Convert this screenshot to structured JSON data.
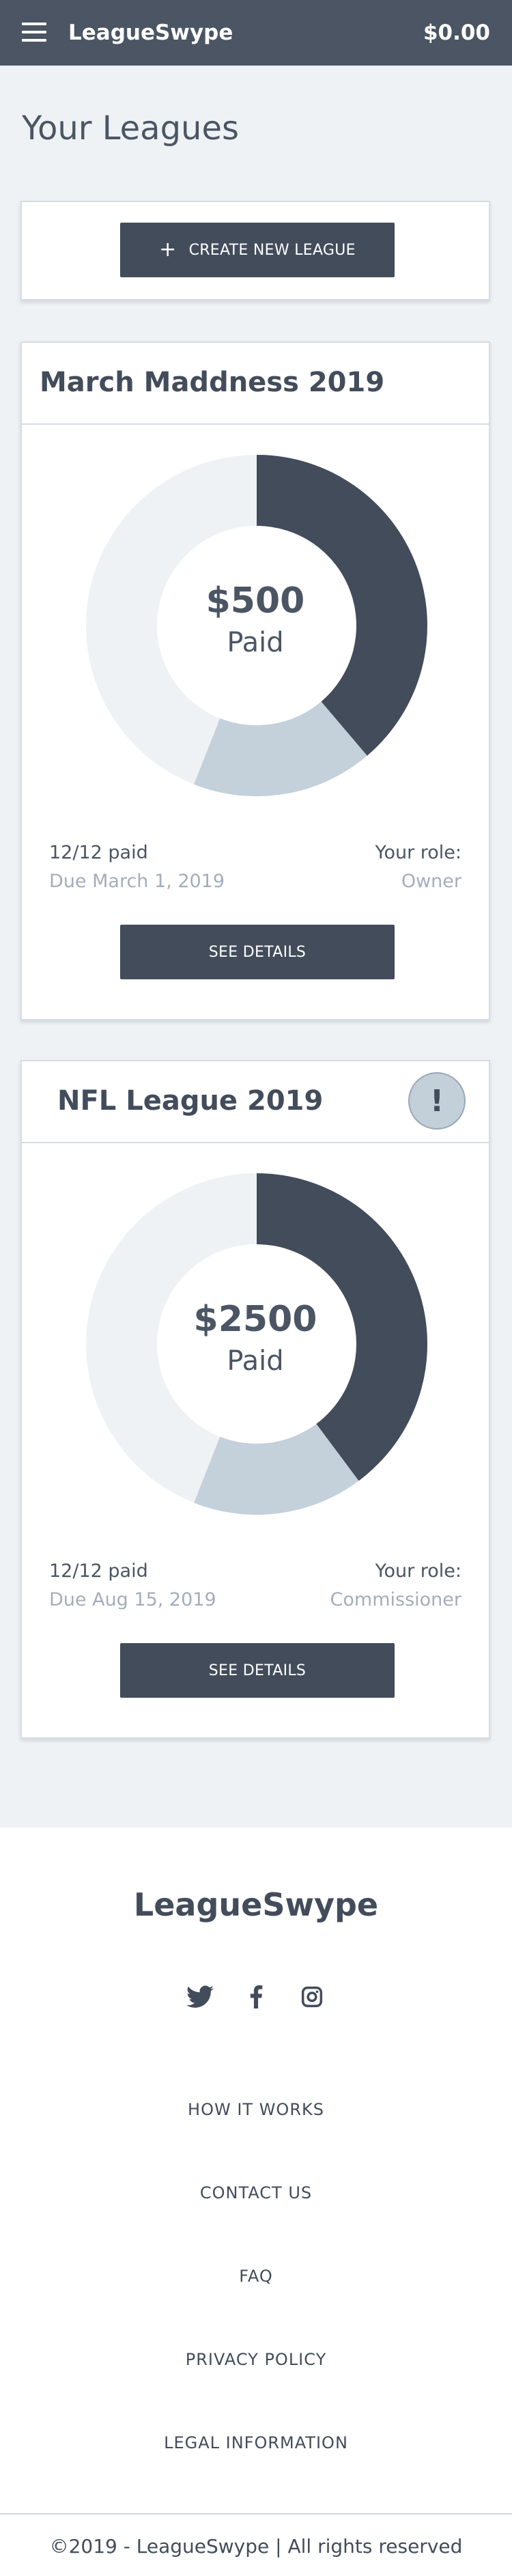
{
  "header": {
    "app_title": "LeagueSwype",
    "balance": "$0.00"
  },
  "page": {
    "title": "Your Leagues"
  },
  "create_button": {
    "label": "CREATE NEW LEAGUE"
  },
  "leagues": [
    {
      "name": "March Maddness 2019",
      "amount": "$500",
      "amount_label": "Paid",
      "paid_count": "12/12 paid",
      "due": "Due March 1, 2019",
      "role_label": "Your role:",
      "role": "Owner",
      "button": "SEE DETAILS",
      "alert": false,
      "segments": [
        0.388,
        0.172,
        0.44
      ]
    },
    {
      "name": "NFL League 2019",
      "amount": "$2500",
      "amount_label": "Paid",
      "paid_count": "12/12 paid",
      "due": "Due Aug 15, 2019",
      "role_label": "Your role:",
      "role": "Commissioner",
      "button": "SEE DETAILS",
      "alert": true,
      "alert_symbol": "!",
      "segments": [
        0.398,
        0.162,
        0.44
      ]
    }
  ],
  "colors": {
    "segments": [
      "#434c5b",
      "#c4d0da",
      "#eef2f5"
    ]
  },
  "footer": {
    "brand": "LeagueSwype",
    "social": [
      "twitter-icon",
      "facebook-icon",
      "instagram-icon"
    ],
    "links": [
      "HOW IT WORKS",
      "CONTACT US",
      "FAQ",
      "PRIVACY POLICY",
      "LEGAL INFORMATION"
    ],
    "copyright": "©2019 - LeagueSwype | All rights reserved"
  }
}
